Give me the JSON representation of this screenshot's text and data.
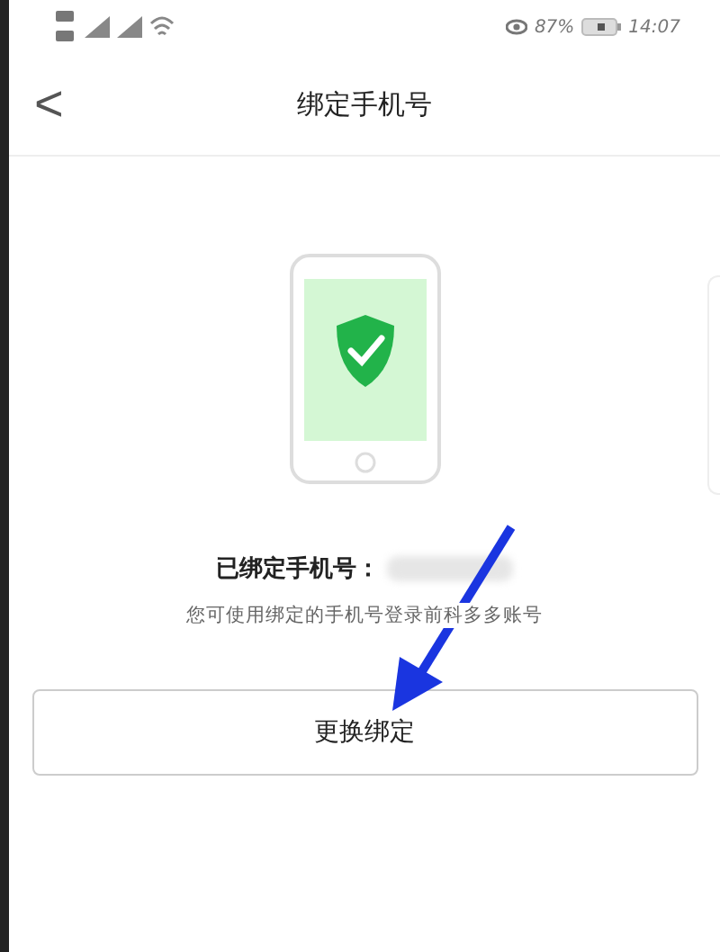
{
  "status_bar": {
    "battery_percent": "87%",
    "time": "14:07"
  },
  "header": {
    "back": "<",
    "title": "绑定手机号"
  },
  "bound": {
    "label": "已绑定手机号：",
    "hint": "您可使用绑定的手机号登录前科多多账号"
  },
  "button": {
    "label": "更换绑定"
  }
}
